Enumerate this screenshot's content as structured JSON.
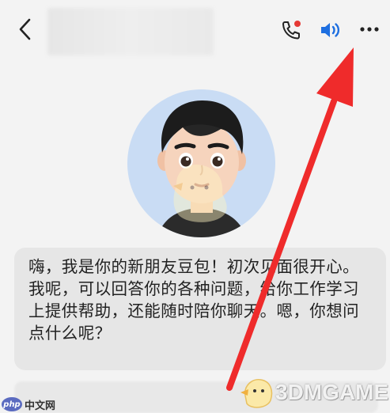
{
  "header": {
    "back_icon": "chevron-left-icon",
    "call_icon": "phone-icon",
    "speaker_icon": "speaker-icon",
    "more_icon": "more-dots-icon"
  },
  "message": {
    "text": "嗨，我是你的新朋友豆包！初次见面很开心。我呢，可以回答你的各种问题，给你工作学习上提供帮助，还能随时陪你聊天。嗯，你想问点什么呢？"
  },
  "watermarks": {
    "left_logo": "php",
    "left_text": "中文网",
    "right_text": "3DMGAME"
  },
  "colors": {
    "accent_blue": "#1e6fe0",
    "notify_red": "#e53935",
    "arrow_red": "#ef2b2b",
    "bubble_bg": "#e6e6e6"
  }
}
